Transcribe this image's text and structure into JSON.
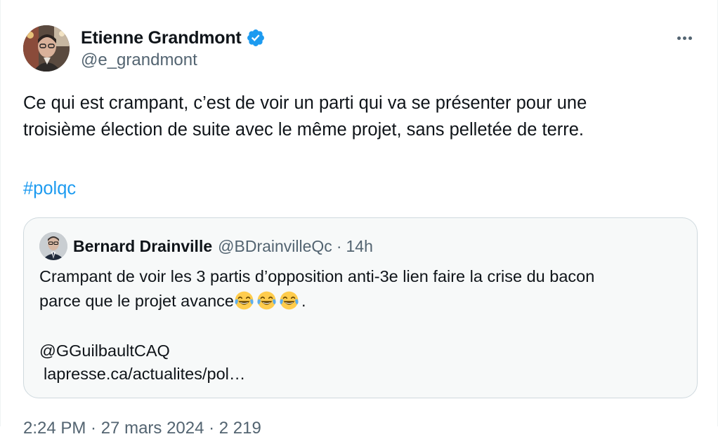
{
  "author": {
    "display_name": "Etienne Grandmont",
    "handle": "@e_grandmont",
    "verified": true
  },
  "more_icon": "more-horizontal-icon",
  "tweet": {
    "text_line1": "Ce qui est crampant, c’est de voir un parti qui va se présenter pour une",
    "text_line2": "troisième élection de suite avec le même projet, sans pelletée de terre.",
    "hashtag": "#polqc"
  },
  "quoted": {
    "display_name": "Bernard Drainville",
    "handle": "@BDrainvilleQc",
    "separator": "·",
    "time": "14h",
    "text_line1": "Crampant de voir les 3 partis d’opposition anti-3e lien faire la crise du bacon",
    "text_line2": "parce que le projet avance",
    "text_line2_end": ".",
    "emoji": "face-with-tears-of-joy",
    "emoji_count": 3,
    "mention": "@GGuilbaultCAQ",
    "link": "lapresse.ca/actualites/pol…"
  },
  "footer": {
    "meta": "2:24 PM · 27 mars 2024 · 2 219"
  },
  "colors": {
    "link_blue": "#1d9bf0",
    "secondary_text": "#536471",
    "quote_bg": "#f7f9f9",
    "quote_border": "#cfd9de"
  }
}
